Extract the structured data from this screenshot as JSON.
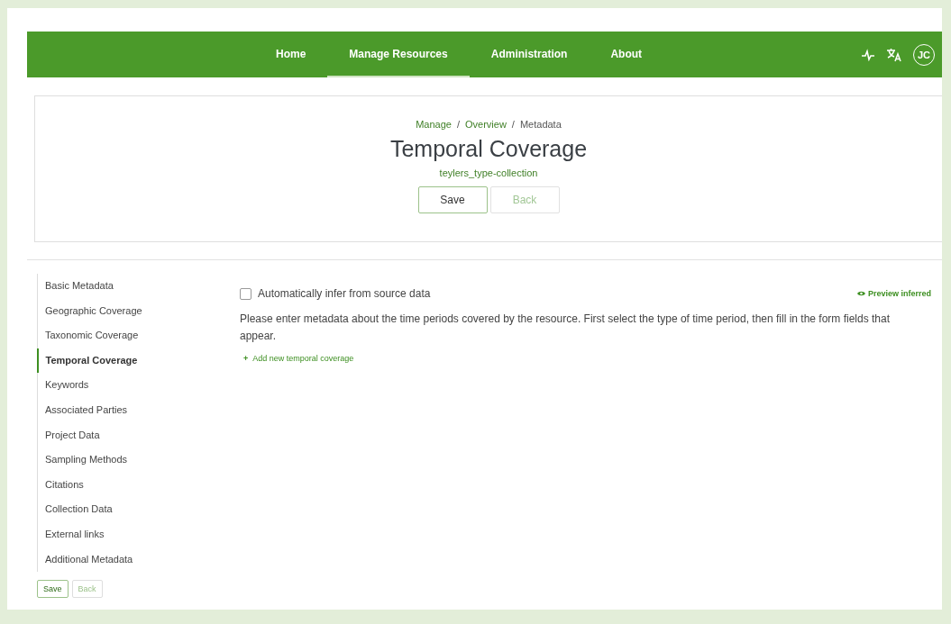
{
  "nav": {
    "items": [
      {
        "label": "Home",
        "selected": false
      },
      {
        "label": "Manage Resources",
        "selected": true
      },
      {
        "label": "Administration",
        "selected": false
      },
      {
        "label": "About",
        "selected": false
      }
    ],
    "avatar": "JC"
  },
  "header": {
    "breadcrumbs": [
      {
        "label": "Manage",
        "kind": "link"
      },
      {
        "label": "Overview",
        "kind": "link"
      },
      {
        "label": "Metadata",
        "kind": "current"
      }
    ],
    "separator": "/",
    "title": "Temporal Coverage",
    "subtitle": "teylers_type-collection",
    "buttons": [
      {
        "label": "Save",
        "disabled": false
      },
      {
        "label": "Back",
        "disabled": true
      }
    ]
  },
  "sidebar": {
    "items": [
      {
        "label": "Basic Metadata",
        "selected": false
      },
      {
        "label": "Geographic Coverage",
        "selected": false
      },
      {
        "label": "Taxonomic Coverage",
        "selected": false
      },
      {
        "label": "Temporal Coverage",
        "selected": true
      },
      {
        "label": "Keywords",
        "selected": false
      },
      {
        "label": "Associated Parties",
        "selected": false
      },
      {
        "label": "Project Data",
        "selected": false
      },
      {
        "label": "Sampling Methods",
        "selected": false
      },
      {
        "label": "Citations",
        "selected": false
      },
      {
        "label": "Collection Data",
        "selected": false
      },
      {
        "label": "External links",
        "selected": false
      },
      {
        "label": "Additional Metadata",
        "selected": false
      }
    ],
    "buttons": [
      {
        "label": "Save",
        "disabled": false
      },
      {
        "label": "Back",
        "disabled": true
      }
    ]
  },
  "content": {
    "infer": {
      "label": "Automatically infer from source data",
      "checked": false
    },
    "preview": "Preview inferred",
    "description": "Please enter metadata about the time periods covered by the resource. First select the type of time period, then fill in the form fields that appear.",
    "add_icon": "+",
    "add_link": "Add new temporal coverage"
  }
}
